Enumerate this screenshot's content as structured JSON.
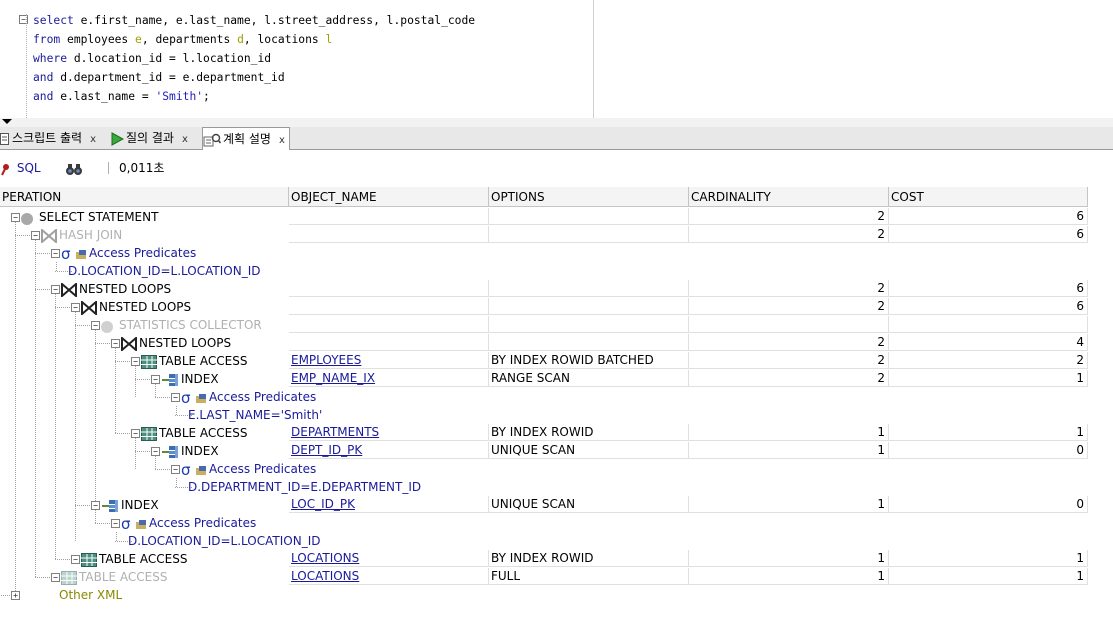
{
  "editor": {
    "lines": [
      [
        {
          "t": "select",
          "k": "kw"
        },
        {
          "t": " e.first_name, e.last_name, l.street_address, l.postal_code",
          "k": ""
        }
      ],
      [
        {
          "t": "from",
          "k": "kw"
        },
        {
          "t": " employees ",
          "k": ""
        },
        {
          "t": "e",
          "k": "alias"
        },
        {
          "t": ", departments ",
          "k": ""
        },
        {
          "t": "d",
          "k": "alias"
        },
        {
          "t": ", locations ",
          "k": ""
        },
        {
          "t": "l",
          "k": "alias"
        }
      ],
      [
        {
          "t": "where",
          "k": "kw"
        },
        {
          "t": " d.location_id = l.location_id",
          "k": ""
        }
      ],
      [
        {
          "t": "and",
          "k": "kw"
        },
        {
          "t": " d.department_id = e.department_id",
          "k": ""
        }
      ],
      [
        {
          "t": "and",
          "k": "kw"
        },
        {
          "t": " e.last_name = ",
          "k": ""
        },
        {
          "t": "'Smith'",
          "k": "str"
        },
        {
          "t": ";",
          "k": ""
        }
      ]
    ]
  },
  "tabs": [
    {
      "label": "스크립트 출력",
      "close": "x"
    },
    {
      "label": "질의 결과",
      "close": "x"
    },
    {
      "label": "계획 설명",
      "close": "x",
      "active": true
    }
  ],
  "toolbar": {
    "sql_label": "SQL",
    "elapsed": "0,011초"
  },
  "columns": [
    "PERATION",
    "OBJECT_NAME",
    "OPTIONS",
    "CARDINALITY",
    "COST"
  ],
  "rows": [
    {
      "label": "SELECT STATEMENT",
      "icon": "dot",
      "level": 0,
      "obj": "",
      "opt": "",
      "card": "2",
      "cost": "6"
    },
    {
      "label": "HASH JOIN",
      "icon": "join",
      "level": 1,
      "gray": true,
      "obj": "",
      "opt": "",
      "card": "2",
      "cost": "6"
    },
    {
      "label": "Access Predicates",
      "icon": "pred",
      "level": 2,
      "pred": true
    },
    {
      "label": "D.LOCATION_ID=L.LOCATION_ID",
      "icon": "",
      "level": 3,
      "pred": true,
      "leaf": true
    },
    {
      "label": "NESTED LOOPS",
      "icon": "join",
      "level": 2,
      "obj": "",
      "opt": "",
      "card": "2",
      "cost": "6"
    },
    {
      "label": "NESTED LOOPS",
      "icon": "join",
      "level": 3,
      "obj": "",
      "opt": "",
      "card": "2",
      "cost": "6"
    },
    {
      "label": "STATISTICS COLLECTOR",
      "icon": "dot",
      "level": 4,
      "gray": true,
      "obj": "",
      "opt": "",
      "card": "",
      "cost": ""
    },
    {
      "label": "NESTED LOOPS",
      "icon": "join",
      "level": 5,
      "obj": "",
      "opt": "",
      "card": "2",
      "cost": "4"
    },
    {
      "label": "TABLE ACCESS",
      "icon": "table",
      "level": 6,
      "obj": "EMPLOYEES",
      "opt": "BY INDEX ROWID BATCHED",
      "card": "2",
      "cost": "2"
    },
    {
      "label": "INDEX",
      "icon": "index",
      "level": 7,
      "obj": "EMP_NAME_IX",
      "opt": "RANGE SCAN",
      "card": "2",
      "cost": "1"
    },
    {
      "label": "Access Predicates",
      "icon": "pred",
      "level": 8,
      "pred": true
    },
    {
      "label": "E.LAST_NAME='Smith'",
      "icon": "",
      "level": 9,
      "pred": true,
      "leaf": true
    },
    {
      "label": "TABLE ACCESS",
      "icon": "table",
      "level": 6,
      "obj": "DEPARTMENTS",
      "opt": "BY INDEX ROWID",
      "card": "1",
      "cost": "1"
    },
    {
      "label": "INDEX",
      "icon": "index",
      "level": 7,
      "obj": "DEPT_ID_PK",
      "opt": "UNIQUE SCAN",
      "card": "1",
      "cost": "0"
    },
    {
      "label": "Access Predicates",
      "icon": "pred",
      "level": 8,
      "pred": true
    },
    {
      "label": "D.DEPARTMENT_ID=E.DEPARTMENT_ID",
      "icon": "",
      "level": 9,
      "pred": true,
      "leaf": true
    },
    {
      "label": "INDEX",
      "icon": "index",
      "level": 4,
      "obj": "LOC_ID_PK",
      "opt": "UNIQUE SCAN",
      "card": "1",
      "cost": "0"
    },
    {
      "label": "Access Predicates",
      "icon": "pred",
      "level": 5,
      "pred": true
    },
    {
      "label": "D.LOCATION_ID=L.LOCATION_ID",
      "icon": "",
      "level": 6,
      "pred": true,
      "leaf": true
    },
    {
      "label": "TABLE ACCESS",
      "icon": "table",
      "level": 3,
      "obj": "LOCATIONS",
      "opt": "BY INDEX ROWID",
      "card": "1",
      "cost": "1"
    },
    {
      "label": "TABLE ACCESS",
      "icon": "table",
      "level": 2,
      "gray": true,
      "obj": "LOCATIONS",
      "opt": "FULL",
      "card": "1",
      "cost": "1"
    },
    {
      "label": "Other XML",
      "icon": "",
      "level": 0,
      "xml": true,
      "expandable": true
    }
  ]
}
